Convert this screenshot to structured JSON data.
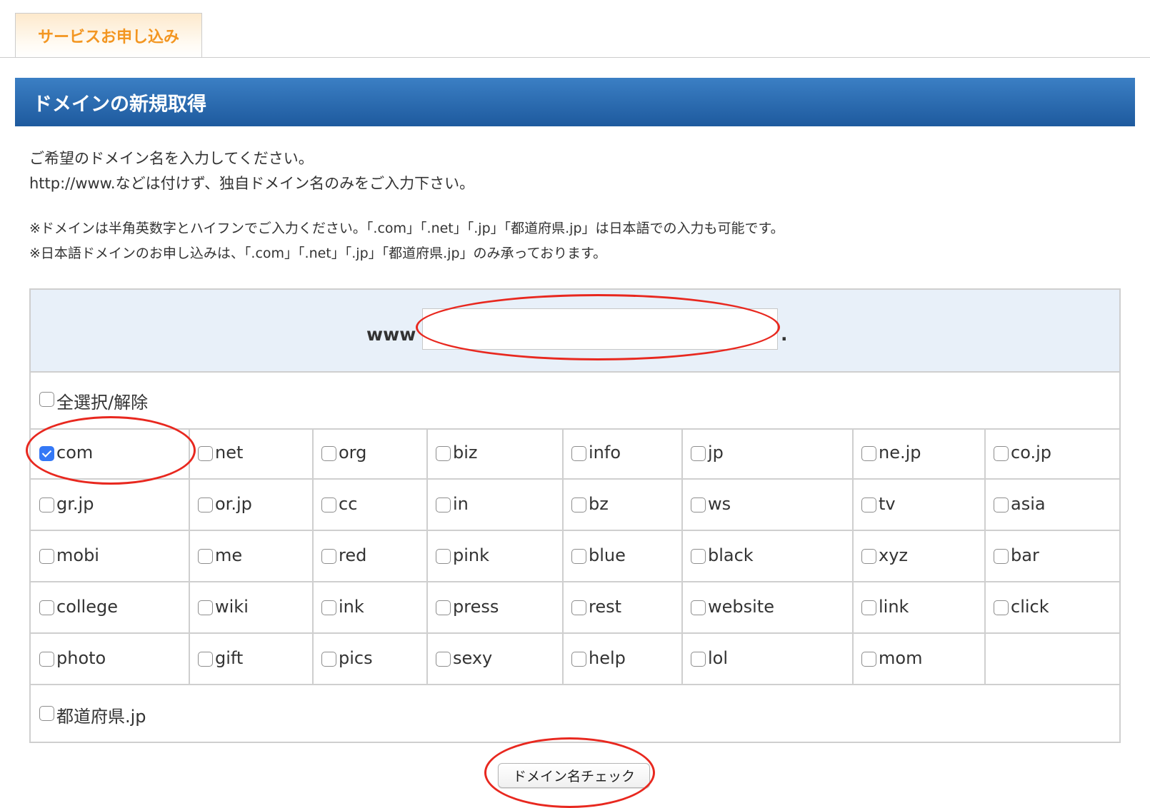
{
  "tab": {
    "label": "サービスお申し込み"
  },
  "banner": {
    "title": "ドメインの新規取得"
  },
  "intro": {
    "line1": "ご希望のドメイン名を入力してください。",
    "line2": "http://www.などは付けず、独自ドメイン名のみをご入力下さい。"
  },
  "notes": {
    "line1": "※ドメインは半角英数字とハイフンでご入力ください。「.com」「.net」「.jp」「都道府県.jp」は日本語での入力も可能です。",
    "line2": "※日本語ドメインのお申し込みは、「.com」「.net」「.jp」「都道府県.jp」のみ承っております。"
  },
  "domain_input": {
    "prefix": "www",
    "suffix": ".",
    "value": ""
  },
  "select_all": {
    "label": "全選択/解除",
    "checked": false
  },
  "tlds": [
    [
      "com",
      "net",
      "org",
      "biz",
      "info",
      "jp",
      "ne.jp",
      "co.jp"
    ],
    [
      "gr.jp",
      "or.jp",
      "cc",
      "in",
      "bz",
      "ws",
      "tv",
      "asia"
    ],
    [
      "mobi",
      "me",
      "red",
      "pink",
      "blue",
      "black",
      "xyz",
      "bar"
    ],
    [
      "college",
      "wiki",
      "ink",
      "press",
      "rest",
      "website",
      "link",
      "click"
    ],
    [
      "photo",
      "gift",
      "pics",
      "sexy",
      "help",
      "lol",
      "mom",
      ""
    ]
  ],
  "checked_tlds": [
    "com"
  ],
  "prefecture": {
    "label": "都道府県.jp",
    "checked": false
  },
  "check_button": {
    "label": "ドメイン名チェック"
  },
  "colors": {
    "tab_text": "#f39621",
    "banner": "#2266aa",
    "annotation": "#e8281f",
    "checkbox_checked": "#3478f6"
  }
}
